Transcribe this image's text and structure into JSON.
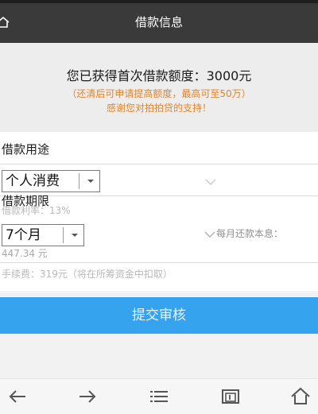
{
  "header": {
    "title": "借款信息"
  },
  "info": {
    "quota_text": "您已获得首次借款额度：3000元",
    "note_line1": "（还清后可申请提高额度，最高可至50万）",
    "note_line2": "感谢您对拍拍贷的支持！"
  },
  "form": {
    "purpose_label": "借款用途",
    "purpose_value": "个人消费",
    "term_label": "借款期限",
    "rate_text": "借款利率：13%",
    "term_value": "7个月",
    "monthly_label": "每月还款本息：",
    "monthly_value": "447.34 元",
    "fee_text": "手续费：319元（将在所筹资金中扣取）"
  },
  "submit": {
    "label": "提交审核"
  },
  "colors": {
    "header_bg": "#3a3a3a",
    "accent_blue": "#36a3ef",
    "note_orange": "#e0852a"
  },
  "icons": {
    "top_left": "home-icon",
    "nav": [
      "arrow-left-icon",
      "arrow-right-icon",
      "menu-icon",
      "tabs-icon",
      "home-icon"
    ]
  }
}
